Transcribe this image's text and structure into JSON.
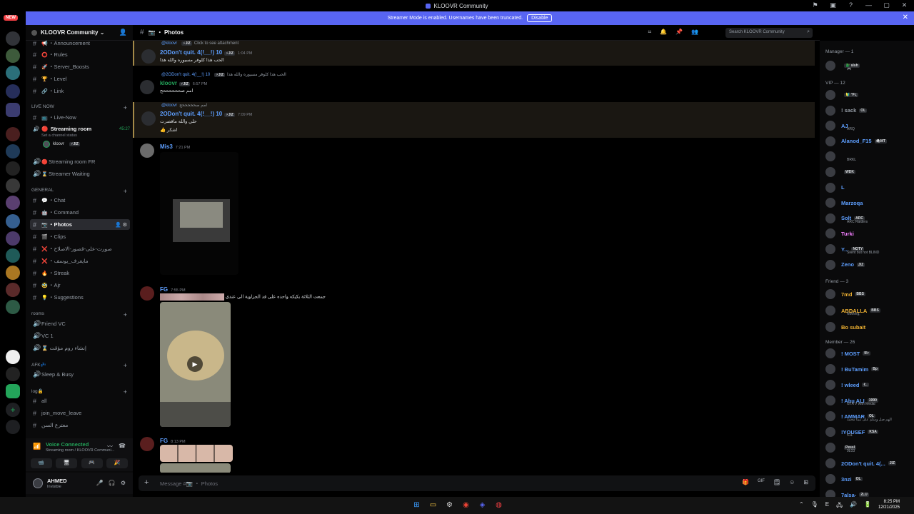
{
  "window": {
    "title": "KLOOVR Community",
    "controls": [
      "⚑",
      "▣",
      "?",
      "—",
      "▢",
      "✕"
    ]
  },
  "banner": {
    "message": "Streamer Mode is enabled. Usernames have been truncated.",
    "disable_label": "Disable",
    "close": "✕",
    "color": "#5865f2"
  },
  "rail": {
    "new_label": "NEW"
  },
  "guild": {
    "name": "KLOOVR Community",
    "chevron": "⌄"
  },
  "channels": {
    "top": [
      {
        "emoji": "📢",
        "label": "Announcement"
      },
      {
        "emoji": "⭕",
        "label": "Rules"
      },
      {
        "emoji": "🚀",
        "label": "Server_Boosts"
      },
      {
        "emoji": "🏆",
        "label": "Level"
      },
      {
        "emoji": "🔗",
        "label": "Link"
      }
    ],
    "live_now_label": "LIVE NOW",
    "live_now_channel": {
      "emoji": "📺",
      "label": "Live-Now"
    },
    "streaming_room": {
      "label": "Streaming room",
      "time": "45:27",
      "status": "Set a channel status",
      "user": "kloovr",
      "user_tag": "⚡JIZ"
    },
    "voice_live": [
      {
        "emoji": "🔴",
        "label": "Streaming room FR"
      },
      {
        "emoji": "⌛",
        "label": "Streamer Waiting"
      }
    ],
    "general_label": "GENERAL",
    "general": [
      {
        "emoji": "💬",
        "label": "Chat"
      },
      {
        "emoji": "🤖",
        "label": "Command"
      },
      {
        "emoji": "📷",
        "label": "Photos",
        "active": true
      },
      {
        "emoji": "🎬",
        "label": "Clips"
      },
      {
        "emoji": "❌",
        "label": "صورت-على-قصور-الاصلاح"
      },
      {
        "emoji": "❌",
        "label": "مايعرف_يوسف"
      },
      {
        "emoji": "🔥",
        "label": "Streak"
      },
      {
        "emoji": "🥸",
        "label": "Ajr"
      },
      {
        "emoji": "💡",
        "label": "Suggestions"
      }
    ],
    "rooms_label": "rooms",
    "rooms": [
      {
        "label": "Friend VC"
      },
      {
        "label": "VC 1"
      },
      {
        "label": "⌛ إنشاء روم مؤقت"
      }
    ],
    "afk_label": "AFK💤",
    "afk": [
      {
        "label": "Sleep & Busy"
      }
    ],
    "log_label": "log🔒",
    "log": [
      {
        "label": "all"
      },
      {
        "label": "join_move_leave"
      },
      {
        "label": "معترع السن"
      }
    ]
  },
  "voice": {
    "title": "Voice Connected",
    "subtitle": "Streaming room / KLOOVR Communi...",
    "buttons": [
      "📹",
      "🖥",
      "🎮",
      "🎉"
    ]
  },
  "user": {
    "name": "AHMED",
    "status": "Invisible"
  },
  "header": {
    "channel": "📷 ・ Photos",
    "search_placeholder": "Search KLOOVR Community",
    "icons": [
      "⌗",
      "🔔",
      "📌",
      "👥"
    ]
  },
  "messages": [
    {
      "reply_to": "@kloovr",
      "reply_tag": "⚡JIZ",
      "reply_text": "Click to see attachment",
      "author": "2ODon't quit. 4(!__!) 10",
      "author_tag": "⚡JIZ",
      "time": "1:04 PM",
      "text": "الحب هذا كلوفر مسيوره والله هذا"
    },
    {
      "reply_to": "@2ODon't quit. 4(!__!) 10",
      "reply_tag": "⚡JIZ",
      "reply_text": "الحب هذا كلوفر مسيوره والله هذا",
      "author": "kloovr",
      "author_tag": "⚡JIZ",
      "time": "6:57 PM",
      "text": "امم صححححححح"
    },
    {
      "reply_to": "@kloovr",
      "reply_tag": "",
      "reply_text": "امم صحححححح",
      "author": "2ODon't quit. 4(!__!) 10",
      "author_tag": "⚡JIZ",
      "time": "7:09 PM",
      "text": "حلي والله ماقصرت",
      "text2": "👍 اشكر"
    },
    {
      "author": "Mis3",
      "time": "7:21 PM",
      "text": ""
    },
    {
      "author": "FG",
      "time": "7:55 PM",
      "text": "جمعت الثلاثة بكيكه واحده على قد الجزاوية الي عندي"
    },
    {
      "author": "FG",
      "time": "8:13 PM",
      "text": ""
    }
  ],
  "composer": {
    "placeholder": "Message #📷 ・ Photos",
    "icons": [
      "🎁",
      "GIF",
      "🗒",
      "☺",
      "⊞"
    ]
  },
  "members": {
    "groups": [
      {
        "label": "Manager — 1"
      },
      {
        "label": "VIP — 12"
      },
      {
        "label": "Friend — 3"
      },
      {
        "label": "Member — 26"
      }
    ],
    "manager": [
      {
        "name": "",
        "tag": "🐉 slsh",
        "color": "#f2f3f5",
        "sub": "🎮"
      }
    ],
    "vip": [
      {
        "name": "",
        "tag": "🔰 ℉ς",
        "color": "#f2f3f5",
        "sub": ""
      },
      {
        "name": "! sack",
        "tag": "OL",
        "color": "#949ba4",
        "sub": ""
      },
      {
        "name": "AJ",
        "tag": "",
        "color": "#5e9fff",
        "sub": "ARQ"
      },
      {
        "name": "Alanod_F15",
        "tag": "🕷MT",
        "color": "#5e9fff",
        "sub": ""
      },
      {
        "name": "",
        "tag": "",
        "color": "#f2f3f5",
        "sub": "BRKL"
      },
      {
        "name": "",
        "tag": "WDK",
        "color": "#f2f3f5",
        "sub": ""
      },
      {
        "name": "L",
        "tag": "",
        "color": "#5e9fff",
        "sub": ""
      },
      {
        "name": "Marzoqa",
        "tag": "",
        "color": "#5e9fff",
        "sub": ""
      },
      {
        "name": "Solt",
        "tag": "ARC",
        "color": "#5e9fff",
        "sub": "ARC Raiders"
      },
      {
        "name": "Turki",
        "tag": "",
        "color": "#f47fff",
        "sub": ""
      },
      {
        "name": "Y...",
        "tag": "NOTY",
        "color": "#5e9fff",
        "sub": "Silent but not BLIND"
      },
      {
        "name": "Zeno",
        "tag": "JIZ",
        "color": "#5e9fff",
        "sub": ""
      }
    ],
    "friend": [
      {
        "name": "7md",
        "tag": "BBS",
        "color": "#f0b232",
        "sub": ""
      },
      {
        "name": "ABDALLA",
        "tag": "BBS",
        "color": "#f0b232",
        "sub": "Nothing,"
      },
      {
        "name": "Bo subait",
        "tag": "",
        "color": "#f0b232",
        "sub": ""
      }
    ],
    "member": [
      {
        "name": "! MOST",
        "tag": "9!r",
        "color": "#5e9fff",
        "sub": ""
      },
      {
        "name": "! BuTamim",
        "tag": "Bp",
        "color": "#5e9fff",
        "sub": ""
      },
      {
        "name": "! wleed",
        "tag": "ℓ..",
        "color": "#5e9fff",
        "sub": ""
      },
      {
        "name": "! Abu ALI",
        "tag": "1990",
        "color": "#5e9fff",
        "sub": "GTA V with Medal"
      },
      {
        "name": "! AMMAR",
        "tag": "OL",
        "color": "#5e9fff",
        "sub": "الهم صل وسلم على نبينا محمد"
      },
      {
        "name": "!YOUSEF",
        "tag": "KSA",
        "color": "#5e9fff",
        "sub": "511"
      },
      {
        "name": "",
        "tag": "Pessl",
        "color": "#f2f3f5",
        "sub": "9L03"
      },
      {
        "name": "2ODon't quit. 4(...",
        "tag": "JIZ",
        "color": "#5e9fff",
        "sub": ""
      },
      {
        "name": "3nzi",
        "tag": "OL",
        "color": "#5e9fff",
        "sub": ""
      },
      {
        "name": "7alsa-",
        "tag": "2LU",
        "color": "#5e9fff",
        "sub": ""
      }
    ]
  },
  "taskbar": {
    "time": "8:25 PM",
    "date": "12/21/2025",
    "tray": [
      "⌃",
      "🎙",
      "E",
      "🖧",
      "🔊",
      "🔋"
    ]
  }
}
